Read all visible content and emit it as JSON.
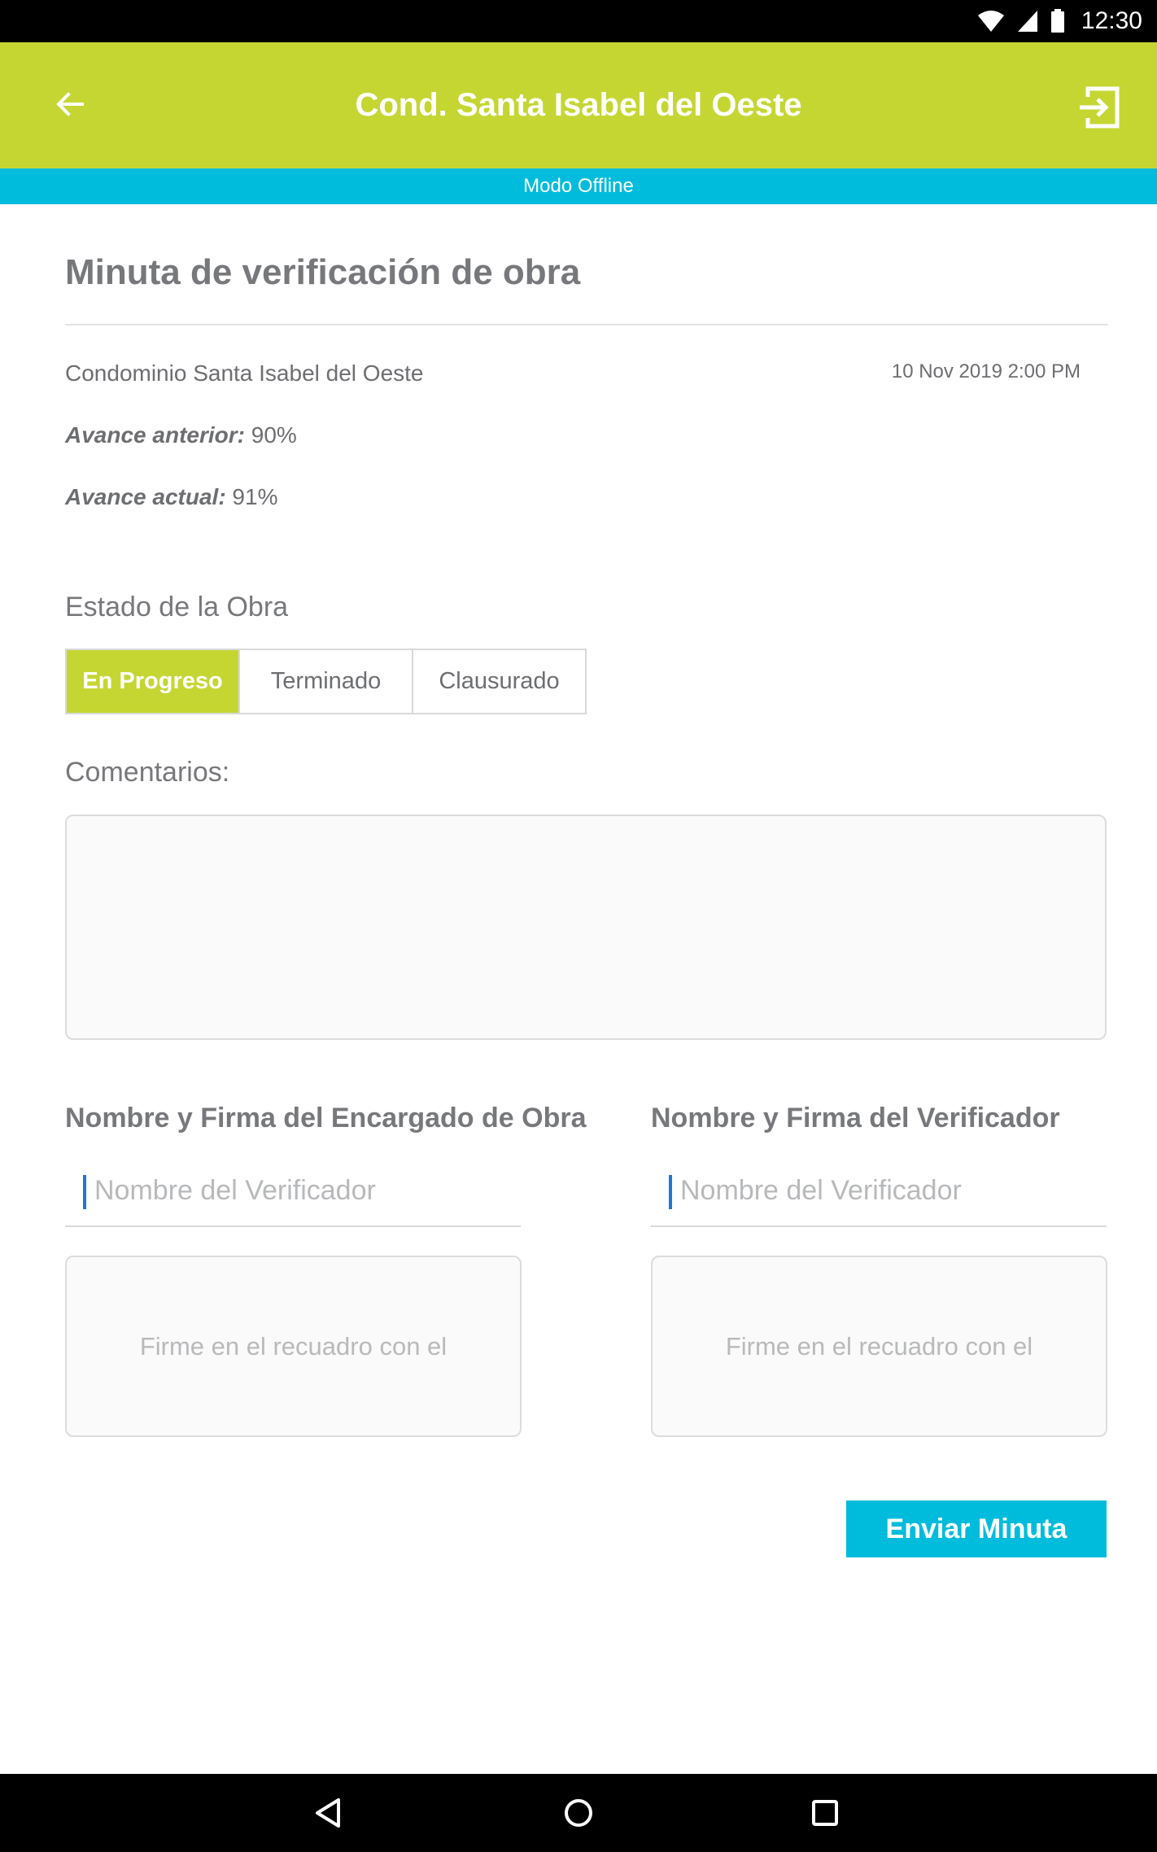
{
  "status_bar": {
    "time": "12:30",
    "icons": [
      "wifi-icon",
      "signal-icon",
      "battery-icon"
    ]
  },
  "app_bar": {
    "title": "Cond. Santa Isabel del Oeste",
    "back_icon": "arrow-left-icon",
    "exit_icon": "exit-icon",
    "color": "#c5d633"
  },
  "offline_banner": {
    "text": "Modo Offline",
    "color": "#00bcdc"
  },
  "form": {
    "title": "Minuta de verificación de obra",
    "condominium": "Condominio Santa Isabel del Oeste",
    "datetime": "10 Nov 2019 2:00 PM",
    "previous_progress_label": "Avance anterior:",
    "previous_progress_value": "90%",
    "current_progress_label": "Avance actual:",
    "current_progress_value": "91%",
    "status_section_label": "Estado de la Obra",
    "status_options": [
      {
        "label": "En Progreso",
        "selected": true
      },
      {
        "label": "Terminado",
        "selected": false
      },
      {
        "label": "Clausurado",
        "selected": false
      }
    ],
    "comments_label": "Comentarios:",
    "comments_value": ""
  },
  "signatures": {
    "left": {
      "title": "Nombre y Firma del Encargado de Obra",
      "name_placeholder": "Nombre del Verificador",
      "name_value": "",
      "pad_hint": "Firme en el recuadro con el"
    },
    "right": {
      "title": "Nombre y Firma del Verificador",
      "name_placeholder": "Nombre del Verificador",
      "name_value": "",
      "pad_hint": "Firme en el recuadro con el"
    }
  },
  "actions": {
    "send_label": "Enviar Minuta"
  },
  "nav_bar": {
    "icons": [
      "back-triangle-icon",
      "home-circle-icon",
      "recents-square-icon"
    ]
  }
}
